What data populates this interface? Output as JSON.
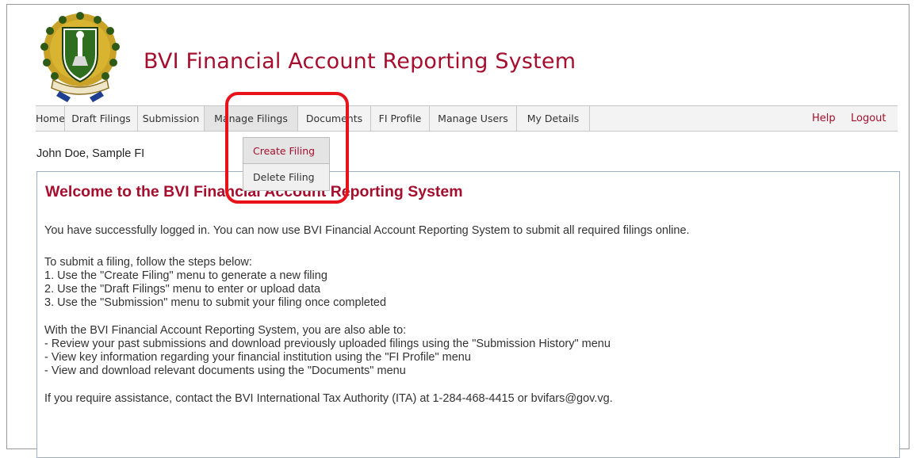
{
  "header": {
    "title": "BVI Financial Account Reporting System",
    "logo_icon": "bvi-coat-of-arms-icon"
  },
  "nav": {
    "items": [
      {
        "label": "Home"
      },
      {
        "label": "Draft Filings"
      },
      {
        "label": "Submission"
      },
      {
        "label": "Manage Filings"
      },
      {
        "label": "Documents"
      },
      {
        "label": "FI Profile"
      },
      {
        "label": "Manage Users"
      },
      {
        "label": "My Details"
      }
    ],
    "help_label": "Help",
    "logout_label": "Logout"
  },
  "dropdown": {
    "items": [
      {
        "label": "Create Filing"
      },
      {
        "label": "Delete Filing"
      }
    ]
  },
  "user_line": "John Doe, Sample FI",
  "main": {
    "welcome": "Welcome to the BVI Financial Account Reporting System",
    "intro": "You have successfully logged in. You can now use BVI Financial Account Reporting System to submit all required filings online.",
    "steps_heading": "To submit a filing, follow the steps below:",
    "steps": [
      "1. Use the \"Create Filing\" menu to generate a new filing",
      "2. Use the \"Draft Filings\" menu to enter or upload data",
      "3. Use the \"Submission\" menu to submit your filing once completed"
    ],
    "also_heading": "With the BVI Financial Account Reporting System, you are also able to:",
    "also_items": [
      "- Review your past submissions and download previously uploaded filings using the \"Submission History\" menu",
      "- View key information regarding your financial institution using the \"FI Profile\" menu",
      "- View and download relevant documents using the \"Documents\" menu"
    ],
    "assistance": "If you require assistance, contact the BVI International Tax Authority (ITA) at 1-284-468-4415 or bvifars@gov.vg."
  },
  "colors": {
    "brand_red": "#a50e2d",
    "highlight_red": "#e8121b",
    "panel_border": "#9fb0c6"
  }
}
